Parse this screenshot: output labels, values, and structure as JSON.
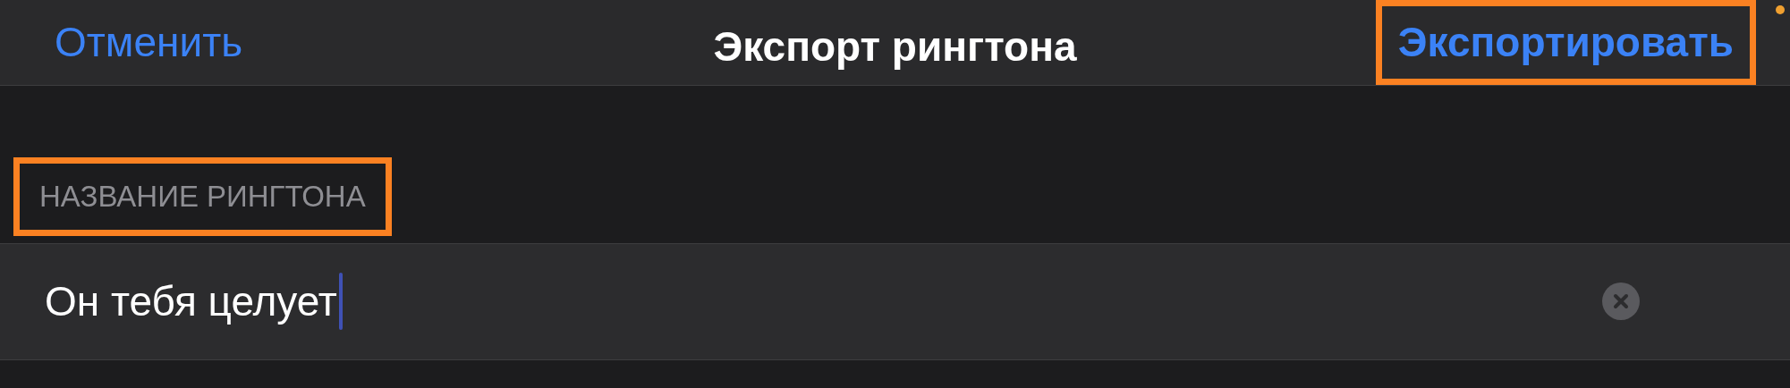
{
  "nav": {
    "cancel": "Отменить",
    "title": "Экспорт рингтона",
    "action": {
      "label": "Экспортировать",
      "highlighted": true
    }
  },
  "section": {
    "label": "НАЗВАНИЕ РИНГТОНА",
    "highlighted": true
  },
  "field": {
    "value": "Он тебя целует",
    "focused": true
  }
}
